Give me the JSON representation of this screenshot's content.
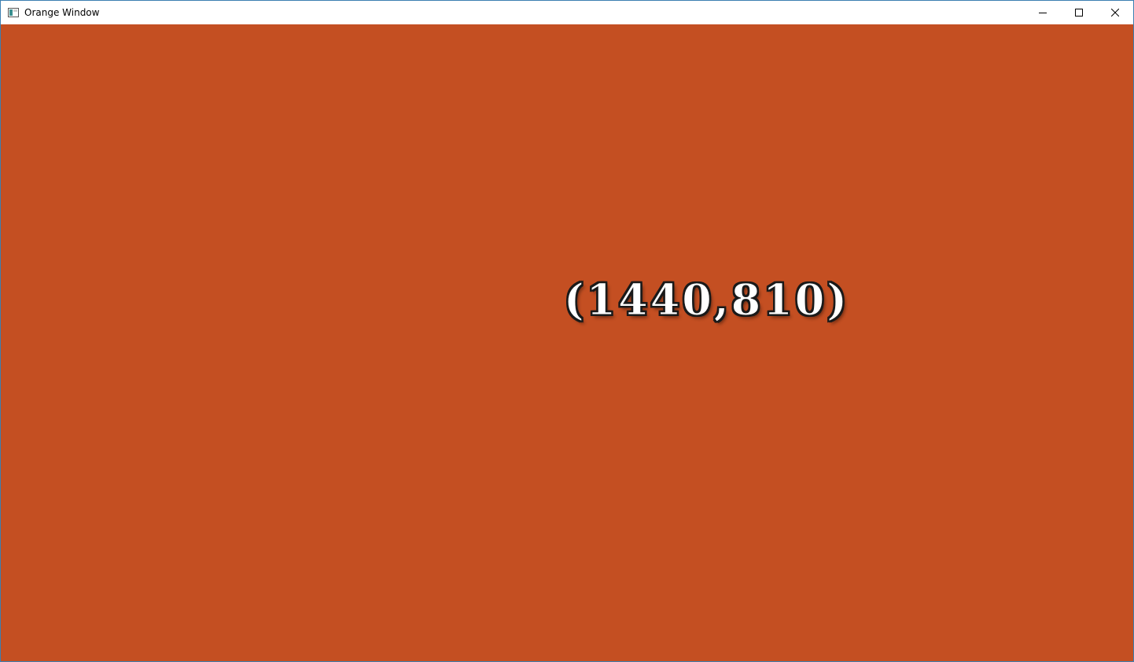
{
  "window": {
    "title": "Orange Window",
    "icons": {
      "app": "app-window-icon",
      "minimize": "minimize-icon",
      "maximize": "maximize-icon",
      "close": "close-icon"
    },
    "colors": {
      "client_background": "#c44f22",
      "border": "#3c7fb1",
      "label_fill": "#ffffff",
      "label_outline": "#1a1a1a"
    }
  },
  "client": {
    "coordinate_label": "(1440,810)"
  }
}
